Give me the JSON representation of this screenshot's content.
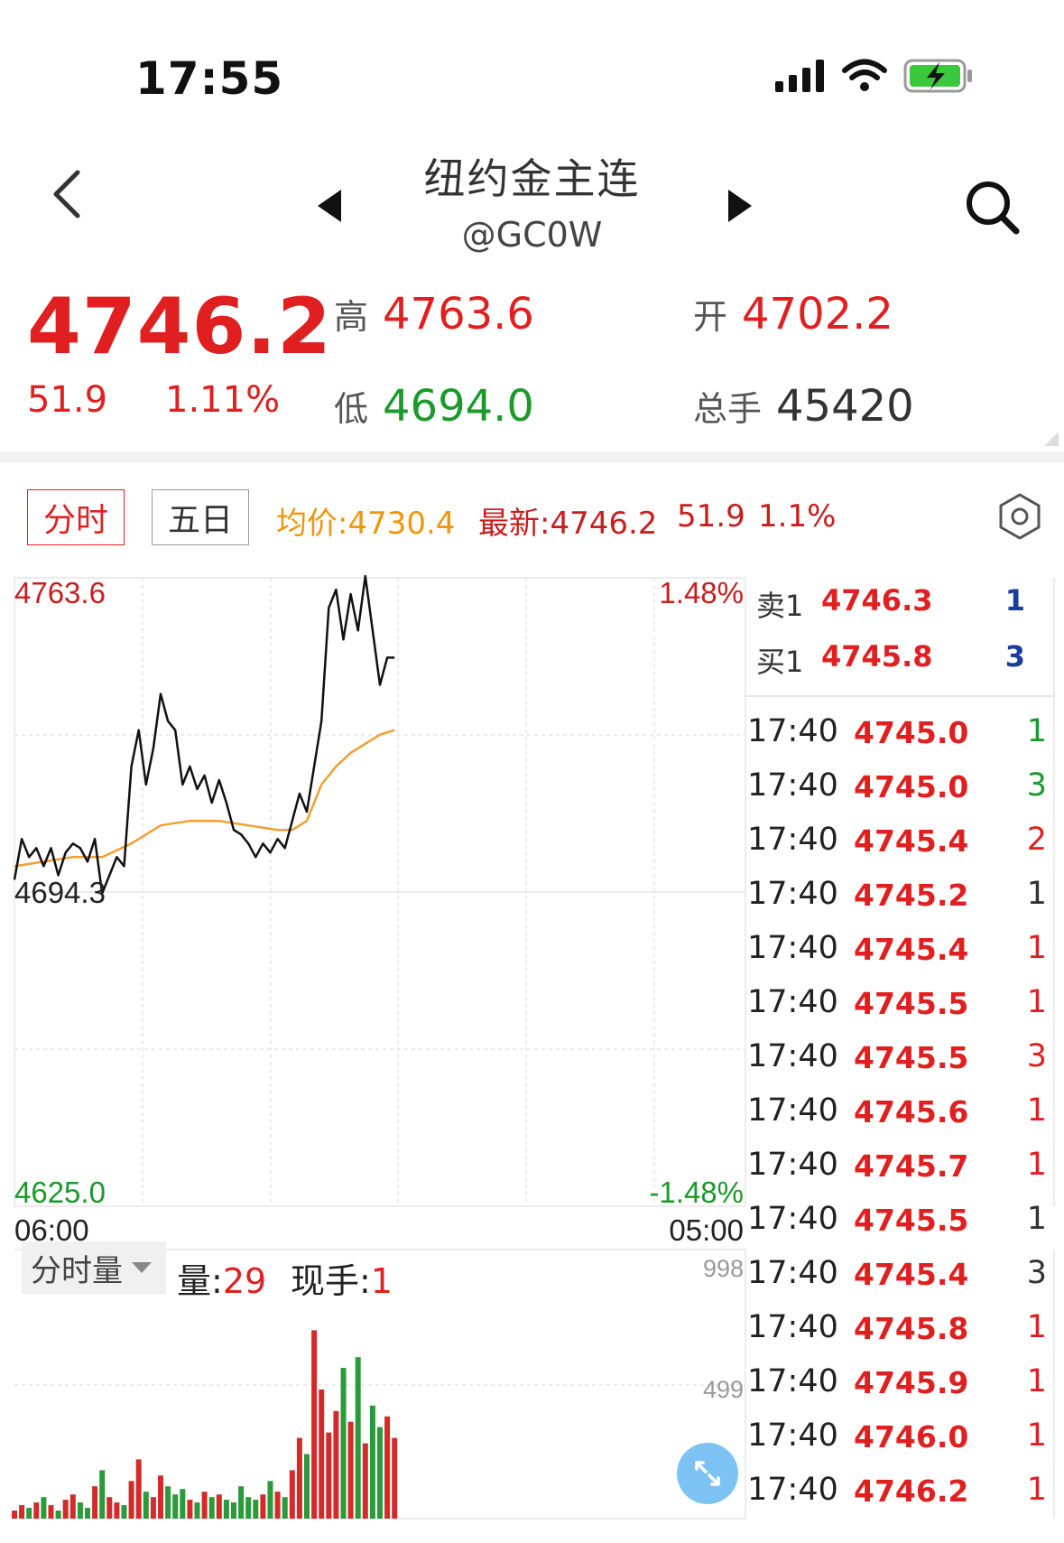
{
  "status": {
    "time": "17:55"
  },
  "nav": {
    "title": "纽约金主连",
    "code": "@GC0W"
  },
  "quote": {
    "last": "4746.2",
    "change": "51.9",
    "change_pct": "1.11%",
    "high_label": "高",
    "high": "4763.6",
    "low_label": "低",
    "low": "4694.0",
    "open_label": "开",
    "open": "4702.2",
    "volume_label": "总手",
    "volume": "45420"
  },
  "tabs": [
    {
      "label": "分时",
      "active": true
    },
    {
      "label": "五日",
      "active": false
    }
  ],
  "toolbar": {
    "avg": "均价:4730.4",
    "latest": "最新:4746.2",
    "chg": "51.9",
    "pct": "1.1%"
  },
  "chart_labels": {
    "y_top": "4763.6",
    "y_mid": "4694.3",
    "y_bottom": "4625.0",
    "pct_top": "1.48%",
    "pct_bottom": "-1.48%",
    "x_start": "06:00",
    "x_end": "05:00",
    "vol_top": "998",
    "vol_mid": "499"
  },
  "volume_panel": {
    "dropdown": "分时量",
    "vol_label": "量:",
    "vol_value": "29",
    "hand_label": "现手:",
    "hand_value": "1"
  },
  "order_book": [
    {
      "label": "卖1",
      "price": "4746.3",
      "qty": "1"
    },
    {
      "label": "买1",
      "price": "4745.8",
      "qty": "3"
    }
  ],
  "ticks": [
    {
      "time": "17:40",
      "price": "4745.0",
      "qty": "1",
      "side": "green"
    },
    {
      "time": "17:40",
      "price": "4745.0",
      "qty": "3",
      "side": "green"
    },
    {
      "time": "17:40",
      "price": "4745.4",
      "qty": "2",
      "side": "red"
    },
    {
      "time": "17:40",
      "price": "4745.2",
      "qty": "1",
      "side": "dark"
    },
    {
      "time": "17:40",
      "price": "4745.4",
      "qty": "1",
      "side": "red"
    },
    {
      "time": "17:40",
      "price": "4745.5",
      "qty": "1",
      "side": "red"
    },
    {
      "time": "17:40",
      "price": "4745.5",
      "qty": "3",
      "side": "red"
    },
    {
      "time": "17:40",
      "price": "4745.6",
      "qty": "1",
      "side": "red"
    },
    {
      "time": "17:40",
      "price": "4745.7",
      "qty": "1",
      "side": "red"
    },
    {
      "time": "17:40",
      "price": "4745.5",
      "qty": "1",
      "side": "dark"
    },
    {
      "time": "17:40",
      "price": "4745.4",
      "qty": "3",
      "side": "dark"
    },
    {
      "time": "17:40",
      "price": "4745.8",
      "qty": "1",
      "side": "red"
    },
    {
      "time": "17:40",
      "price": "4745.9",
      "qty": "1",
      "side": "red"
    },
    {
      "time": "17:40",
      "price": "4746.0",
      "qty": "1",
      "side": "red"
    },
    {
      "time": "17:40",
      "price": "4746.2",
      "qty": "1",
      "side": "red"
    }
  ],
  "chart_data": {
    "type": "line",
    "ylim": [
      4625.0,
      4763.6
    ],
    "x_range": [
      0,
      100
    ],
    "series": [
      {
        "x": [
          0,
          1,
          2,
          3,
          4,
          5,
          6,
          7,
          8,
          9,
          10,
          11,
          12,
          13,
          14,
          15,
          16,
          17,
          18,
          19,
          20,
          21,
          22,
          23,
          24,
          25,
          26,
          27,
          28,
          29,
          30,
          31,
          32,
          33,
          34,
          35,
          36,
          37,
          38,
          39,
          40,
          41,
          42,
          43,
          44,
          45,
          46,
          47,
          48,
          49,
          50,
          51,
          52
        ],
        "values": [
          4697,
          4706,
          4702,
          4704,
          4700,
          4704,
          4698,
          4703,
          4705,
          4704,
          4701,
          4706,
          4694,
          4698,
          4702,
          4700,
          4722,
          4730,
          4718,
          4726,
          4738,
          4732,
          4730,
          4718,
          4722,
          4717,
          4720,
          4714,
          4719,
          4714,
          4708,
          4707,
          4705,
          4702,
          4705,
          4703,
          4706,
          4704,
          4710,
          4716,
          4712,
          4722,
          4732,
          4757,
          4761,
          4750,
          4760,
          4752,
          4764,
          4752,
          4740,
          4746,
          4746
        ]
      },
      {
        "x": [
          0,
          4,
          8,
          12,
          16,
          20,
          24,
          28,
          32,
          36,
          38,
          40,
          42,
          44,
          46,
          48,
          50,
          52
        ],
        "values": [
          4700,
          4701,
          4702,
          4702,
          4705,
          4709,
          4710,
          4710,
          4709,
          4708,
          4708,
          4710,
          4718,
          4722,
          4725,
          4727,
          4729,
          4730
        ]
      }
    ],
    "volume": [
      3,
      5,
      4,
      6,
      8,
      5,
      3,
      7,
      9,
      6,
      4,
      12,
      18,
      8,
      6,
      5,
      14,
      22,
      10,
      8,
      16,
      12,
      9,
      11,
      7,
      6,
      10,
      8,
      9,
      7,
      6,
      12,
      8,
      7,
      9,
      14,
      10,
      8,
      18,
      30,
      24,
      70,
      48,
      32,
      40,
      56,
      36,
      60,
      28,
      42,
      34,
      38,
      30
    ]
  }
}
